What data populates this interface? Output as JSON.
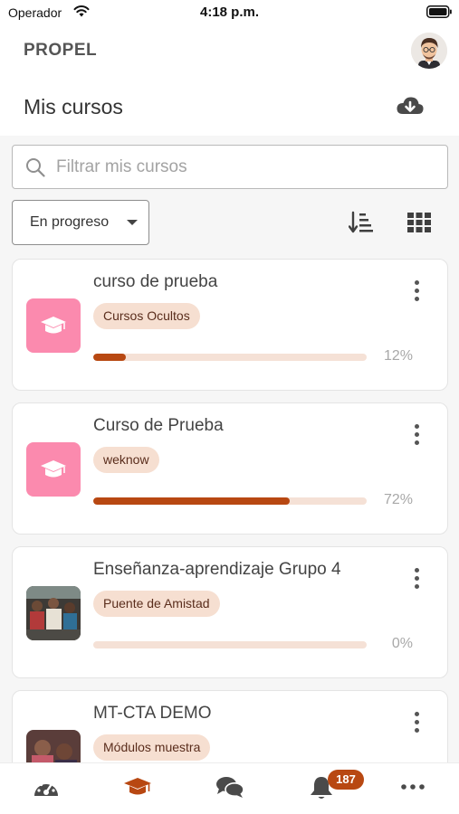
{
  "status_bar": {
    "carrier": "Operador",
    "time": "4:18 p.m."
  },
  "app": {
    "title": "PROPEL"
  },
  "page": {
    "title": "Mis cursos"
  },
  "search": {
    "placeholder": "Filtrar mis cursos",
    "value": ""
  },
  "filter": {
    "selected": "En progreso"
  },
  "colors": {
    "accent": "#b84812",
    "category_chip": "#f6dfd1",
    "progress_track": "#f5e1d6",
    "thumb_pink": "#fb8aae"
  },
  "courses": [
    {
      "name": "curso de prueba",
      "category": "Cursos Ocultos",
      "progress": 12,
      "progress_label": "12%",
      "thumb": "graduation-cap-icon"
    },
    {
      "name": "Curso de Prueba",
      "category": "weknow",
      "progress": 72,
      "progress_label": "72%",
      "thumb": "graduation-cap-icon"
    },
    {
      "name": "Enseñanza-aprendizaje Grupo 4",
      "category": "Puente de Amistad",
      "progress": 0,
      "progress_label": "0%",
      "thumb": "course-photo"
    },
    {
      "name": "MT-CTA DEMO",
      "category": "Módulos muestra",
      "progress": null,
      "progress_label": "",
      "thumb": "course-photo"
    }
  ],
  "tabs": [
    {
      "icon": "dashboard-icon",
      "active": false
    },
    {
      "icon": "graduation-cap-icon",
      "active": true
    },
    {
      "icon": "messages-icon",
      "active": false
    },
    {
      "icon": "bell-icon",
      "active": false
    },
    {
      "icon": "more-horizontal-icon",
      "active": false
    }
  ],
  "notifications": {
    "count": "187"
  }
}
